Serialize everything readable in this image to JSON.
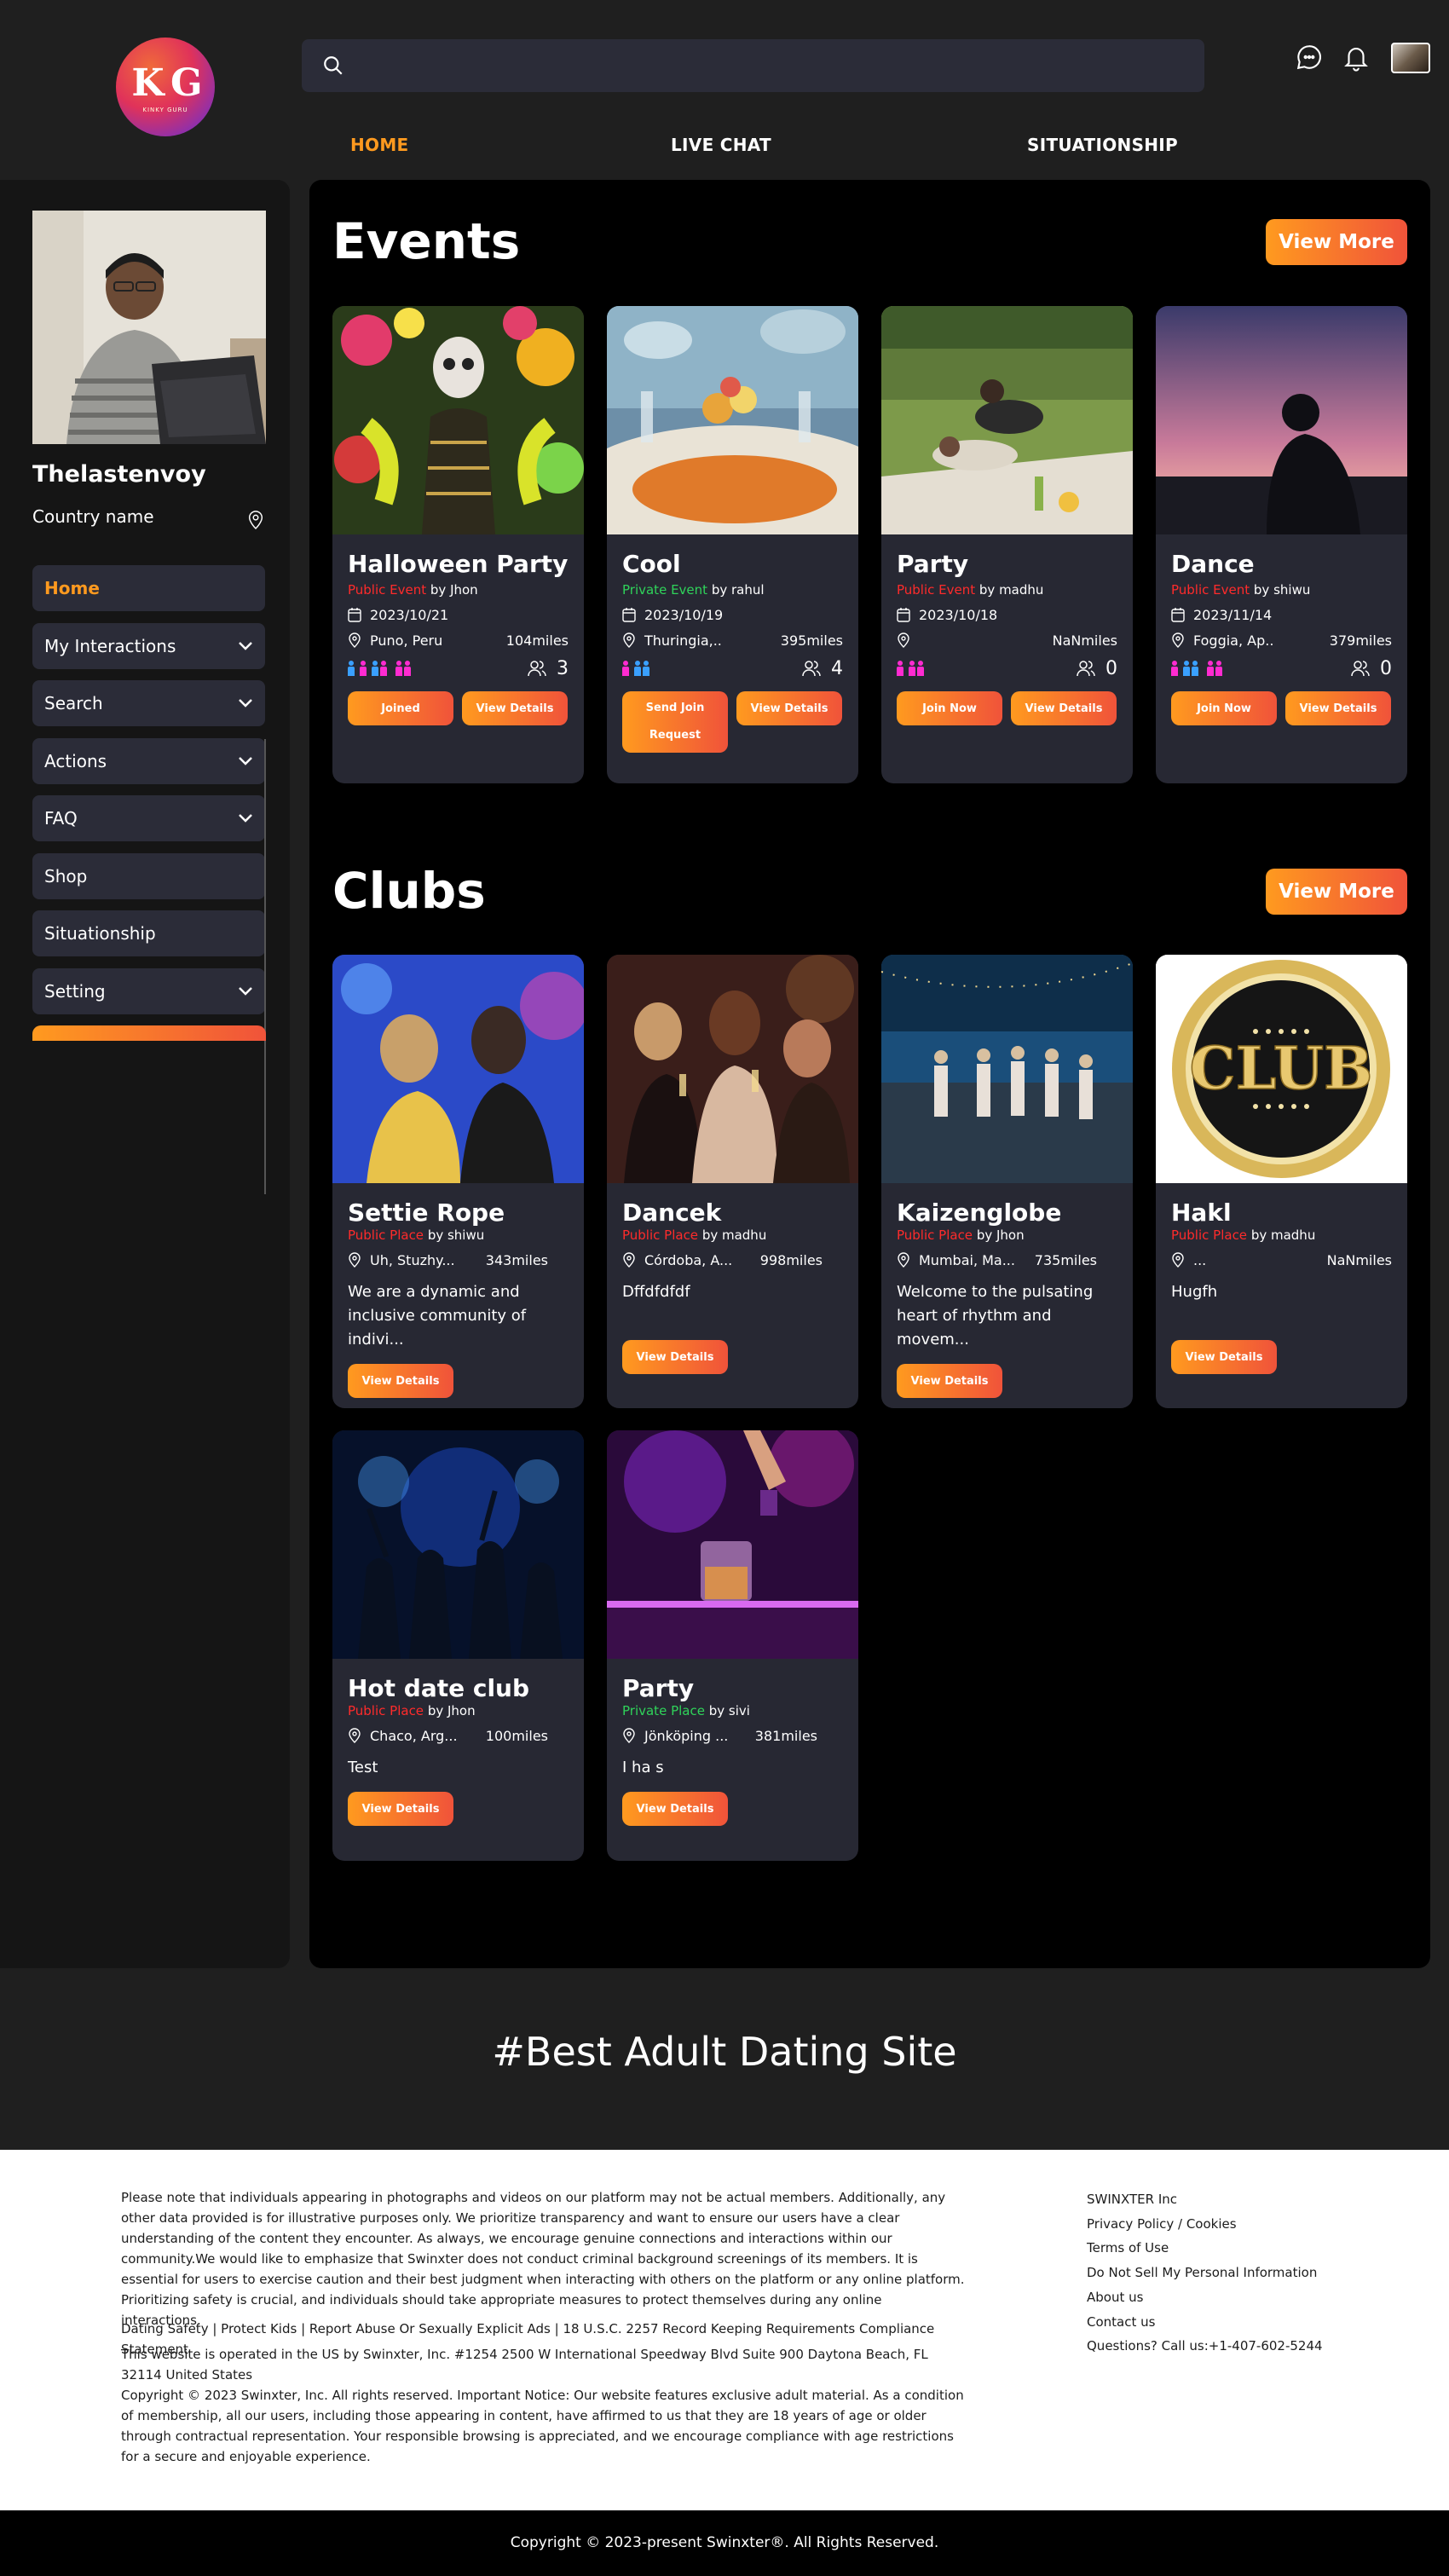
{
  "header": {
    "logo_text": "K G",
    "logo_tagline": "KINKY GURU",
    "search_placeholder": "",
    "nav": [
      "HOME",
      "LIVE CHAT",
      "SITUATIONSHIP"
    ],
    "active_color": "#ff9a1f"
  },
  "sidebar": {
    "username": "Thelastenvoy",
    "country": "Country name",
    "menu": [
      {
        "label": "Home",
        "expandable": false,
        "active": true
      },
      {
        "label": "My Interactions",
        "expandable": true
      },
      {
        "label": "Search",
        "expandable": true
      },
      {
        "label": "Actions",
        "expandable": true
      },
      {
        "label": "FAQ",
        "expandable": true
      },
      {
        "label": "Shop",
        "expandable": false
      },
      {
        "label": "Situationship",
        "expandable": false
      },
      {
        "label": "Setting",
        "expandable": true
      }
    ]
  },
  "events": {
    "title": "Events",
    "view_more": "View More",
    "cards": [
      {
        "title": "Halloween Party",
        "type": "Public Event",
        "by": " by Jhon",
        "date": "2023/10/21",
        "location": "Puno, Peru",
        "distance": "104miles",
        "count": "3",
        "buttons": [
          "Joined",
          "View Details"
        ]
      },
      {
        "title": "Cool",
        "type": "Private Event",
        "by": " by rahul",
        "date": "2023/10/19",
        "location": "Thuringia,..",
        "distance": "395miles",
        "count": "4",
        "buttons": [
          "Send Join Request",
          "View Details"
        ]
      },
      {
        "title": "Party",
        "type": "Public Event",
        "by": " by madhu",
        "date": "2023/10/18",
        "location": "",
        "distance": "NaNmiles",
        "count": "0",
        "buttons": [
          "Join Now",
          "View Details"
        ]
      },
      {
        "title": "Dance",
        "type": "Public Event",
        "by": " by shiwu",
        "date": "2023/11/14",
        "location": "Foggia, Ap..",
        "distance": "379miles",
        "count": "0",
        "buttons": [
          "Join Now",
          "View Details"
        ]
      }
    ]
  },
  "clubs": {
    "title": "Clubs",
    "view_more": "View More",
    "image_text_club": "CLUB",
    "cards": [
      {
        "title": "Settie Rope",
        "type": "Public Place",
        "by": " by shiwu",
        "location": "Uh, Stuzhy...",
        "distance": "343miles",
        "desc": "We are a dynamic and inclusive community of indivi...",
        "button": "View Details"
      },
      {
        "title": "Dancek",
        "type": "Public Place",
        "by": " by madhu",
        "location": "Córdoba, A...",
        "distance": "998miles",
        "desc": "Dffdfdfdf",
        "button": "View Details"
      },
      {
        "title": "Kaizenglobe",
        "type": "Public Place",
        "by": " by Jhon",
        "location": "Mumbai, Ma...",
        "distance": "735miles",
        "desc": "Welcome to the pulsating heart of rhythm and movem...",
        "button": "View Details"
      },
      {
        "title": "Hakl",
        "type": "Public Place",
        "by": " by madhu",
        "location": "...",
        "distance": "NaNmiles",
        "desc": "Hugfh",
        "button": "View Details"
      },
      {
        "title": "Hot date club",
        "type": "Public Place",
        "by": " by Jhon",
        "location": "Chaco, Arg...",
        "distance": "100miles",
        "desc": "Test",
        "button": "View Details"
      },
      {
        "title": "Party",
        "type": "Private Place",
        "by": " by sivi",
        "location": "Jönköping ...",
        "distance": "381miles",
        "desc": "I ha s",
        "button": "View Details"
      }
    ]
  },
  "tagline": "#Best Adult Dating Site",
  "footer": {
    "disclaimer": "Please note that individuals appearing in photographs and videos on our platform may not be actual members. Additionally, any other data provided is for illustrative purposes only. We prioritize transparency and want to ensure our users have a clear understanding of the content they encounter. As always, we encourage genuine connections and interactions within our community.We would like to emphasize that Swinxter does not conduct criminal background screenings of its members. It is essential for users to exercise caution and their best judgment when interacting with others on the platform or any online platform. Prioritizing safety is crucial, and individuals should take appropriate measures to protect themselves during any online interactions.",
    "links_line": "Dating Safety | Protect Kids | Report Abuse Or Sexually Explicit Ads | 18 U.S.C. 2257 Record Keeping Requirements Compliance Statement",
    "operated": "This website is operated in the US by Swinxter, Inc. #1254 2500 W International Speedway Blvd Suite 900 Daytona Beach, FL 32114 United States",
    "copyright_notice": "Copyright © 2023 Swinxter, Inc. All rights reserved. Important Notice: Our website features exclusive adult material. As a condition of membership, all our users, including those appearing in content, have affirmed to us that they are 18 years of age or older through contractual representation. Your responsible browsing is appreciated, and we encourage compliance with age restrictions for a secure and enjoyable experience.",
    "links": [
      "SWINXTER Inc",
      "Privacy Policy / Cookies",
      "Terms of Use",
      "Do Not Sell My Personal Information",
      "About us",
      "Contact us",
      "Questions? Call us:+1-407-602-5244"
    ],
    "bottom": "Copyright © 2023-present Swinxter®. All Rights Reserved."
  },
  "colors": {
    "accent_start": "#ff9a1f",
    "accent_end": "#f0533a",
    "public": "#ff2b2b",
    "private": "#2fd35a",
    "card": "#272833"
  }
}
